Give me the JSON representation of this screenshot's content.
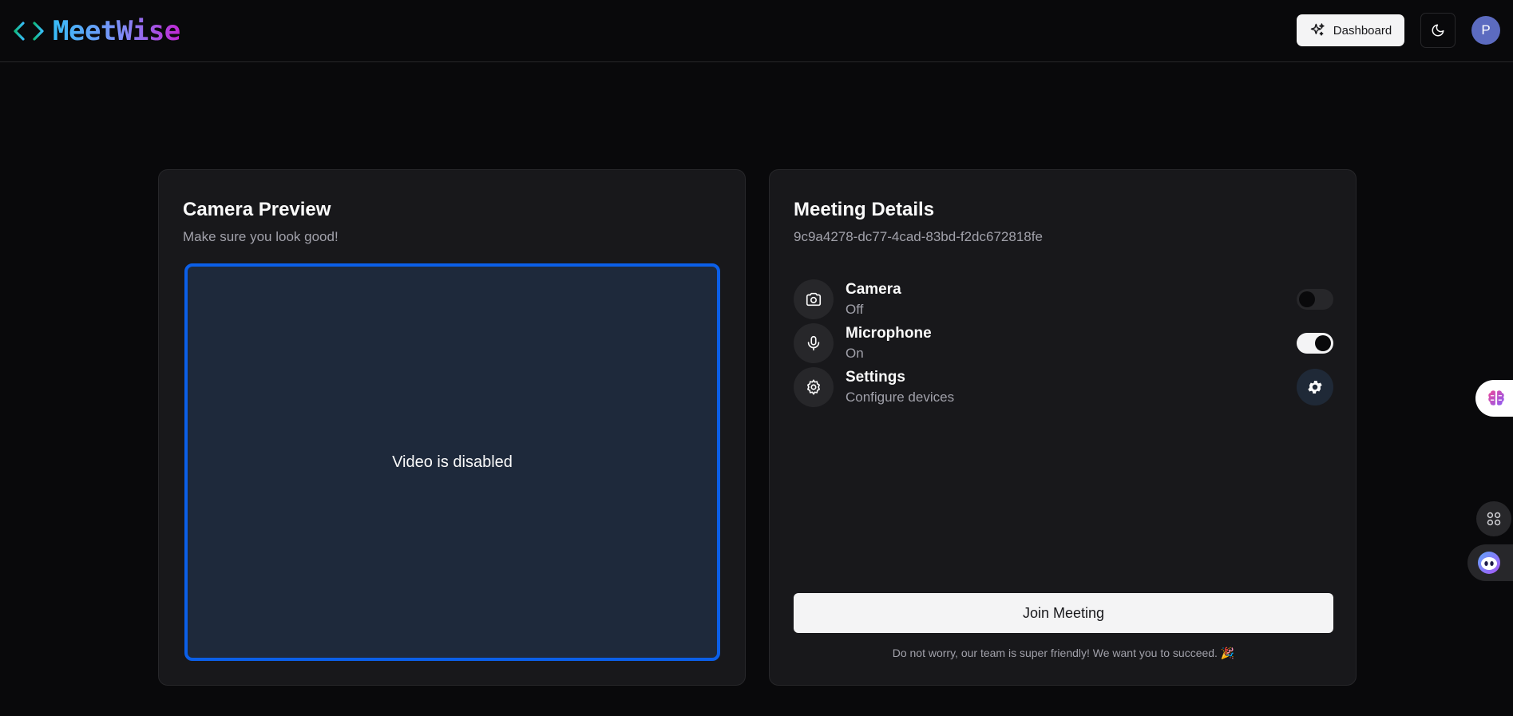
{
  "header": {
    "logo_text": "MeetWise",
    "logo_icon": "code-brackets-icon",
    "dashboard_label": "Dashboard",
    "theme_icon": "moon-icon",
    "avatar_initial": "P"
  },
  "camera_preview": {
    "title": "Camera Preview",
    "subtitle": "Make sure you look good!",
    "video_status": "Video is disabled"
  },
  "meeting_details": {
    "title": "Meeting Details",
    "meeting_id": "9c9a4278-dc77-4cad-83bd-f2dc672818fe",
    "devices": [
      {
        "label": "Camera",
        "status": "Off",
        "icon": "camera-icon",
        "enabled": false
      },
      {
        "label": "Microphone",
        "status": "On",
        "icon": "microphone-icon",
        "enabled": true
      },
      {
        "label": "Settings",
        "status": "Configure devices",
        "icon": "settings-icon"
      }
    ],
    "join_label": "Join Meeting",
    "footnote": "Do not worry, our team is super friendly! We want you to succeed. 🎉"
  },
  "colors": {
    "background": "#09090b",
    "card": "#18181b",
    "accent_border": "#0b5fe8",
    "video_bg": "#1e293b",
    "avatar": "#5c6bc0"
  }
}
